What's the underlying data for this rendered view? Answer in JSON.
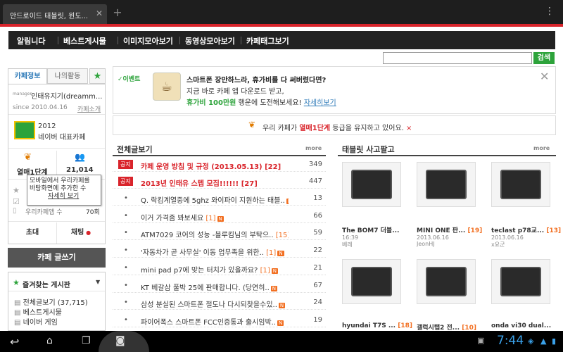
{
  "browser": {
    "tab_title": "안드로이드 태블릿, 윈도...",
    "close_glyph": "✕",
    "newtab_glyph": "+",
    "overflow_glyph": "⋮"
  },
  "nav": [
    "알림니다",
    "베스트게시물",
    "이미지모아보기",
    "동영상모아보기",
    "카페태그보기"
  ],
  "search": {
    "value": "",
    "button": "검색"
  },
  "left": {
    "tab_info": "카페정보",
    "tab_activity": "나의활동",
    "cafe_name": "인태유지기(dreamm...",
    "cafe_prefix": "manager",
    "since": "since 2010.04.16",
    "intro_link": "카페소개",
    "award_year": "2012",
    "award_name": "네이버 대표카페",
    "grade_label": "열매1단계",
    "members": "21,014",
    "tooltip_line1": "모바일에서 우리카페를",
    "tooltip_line2": "바탕화면에 추가한 수",
    "tooltip_link": "자세히 보기",
    "app_count_label": "우리카페앱 수",
    "app_count": "70회",
    "invite": "초대",
    "chat": "채팅",
    "write": "카페 글쓰기",
    "fav_title": "즐겨찾는 게시판",
    "fav_items": [
      "전체글보기 (37,715)",
      "베스트게시물",
      "네이버 게임"
    ]
  },
  "event": {
    "tag": "✓이벤트",
    "line1": "스마트폰 장만하느라, 휴가비를 다 써버렸다면?",
    "line2": "지금 바로 카페 앱 다운로드 받고,",
    "line3_green": "휴가비 100만원",
    "line3_rest": " 행운에 도전해보세요!",
    "more": "자세히보기"
  },
  "grade_msg": {
    "pre": "우리 카페가 ",
    "grade": "열매1단계",
    "post": " 등급을 유지하고 있어요."
  },
  "board": {
    "title": "전체글보기",
    "more": "more",
    "notices": [
      {
        "label": "공지",
        "title": "카페 운영 방침 및 규정 (2013.05.13)",
        "comments": "[22]",
        "count": "349"
      },
      {
        "label": "공지",
        "title": "2013년 인태유 스텝 모집!!!!!!",
        "comments": "[27]",
        "count": "447"
      }
    ],
    "posts": [
      {
        "title": "Q. 락킴계열중에 5ghz 와이파이 지원하는 태블..",
        "count": "13"
      },
      {
        "title": "이거 가격좀 봐보세요",
        "comments": "[1]",
        "count": "66"
      },
      {
        "title": "ATM7029 코어의 성능 -블루킴님의 부탁으..",
        "comments": "[15]",
        "count": "59"
      },
      {
        "title": "'자동차가 곧 사무실' 이동 업무족을 위한..",
        "comments": "[1]",
        "count": "22"
      },
      {
        "title": "mini pad p7에 맞는 터치가 있을까요?",
        "comments": "[1]",
        "count": "21"
      },
      {
        "title": "KT 베갈삼 풀박 25에 판매합니다. (당연히..",
        "count": "67"
      },
      {
        "title": "삼성 분실된 스마트폰 절도나 다시되찾을수있..",
        "count": "24"
      },
      {
        "title": "파이어폭스 스마트폰 FCC인증통과 출시임박..",
        "count": "19"
      },
      {
        "title": "삼성전자 스마트폰 갖다 대면 출력되는 프린..",
        "count": "7"
      }
    ]
  },
  "tablet": {
    "title": "태블릿 사고팔고",
    "more": "more",
    "items": [
      {
        "name": "The BOM7 더블...",
        "date": "16:39",
        "author": "베레"
      },
      {
        "name": "MINI ONE 판...",
        "comments": "[19]",
        "date": "2013.06.16",
        "author": "JeonHJ"
      },
      {
        "name": "teclast p78교...",
        "comments": "[13]",
        "date": "2013.06.16",
        "author": "x요군"
      },
      {
        "name": "hyundai T7S ...",
        "comments": "[18]"
      },
      {
        "name": "갤럭시탭2 전...",
        "comments": "[10]"
      },
      {
        "name": "onda vi30 dual..."
      }
    ]
  },
  "system": {
    "time": "7:44"
  },
  "colors": {
    "accent_red": "#d9242b",
    "accent_green": "#2da33b",
    "badge_orange": "#f26f21"
  }
}
